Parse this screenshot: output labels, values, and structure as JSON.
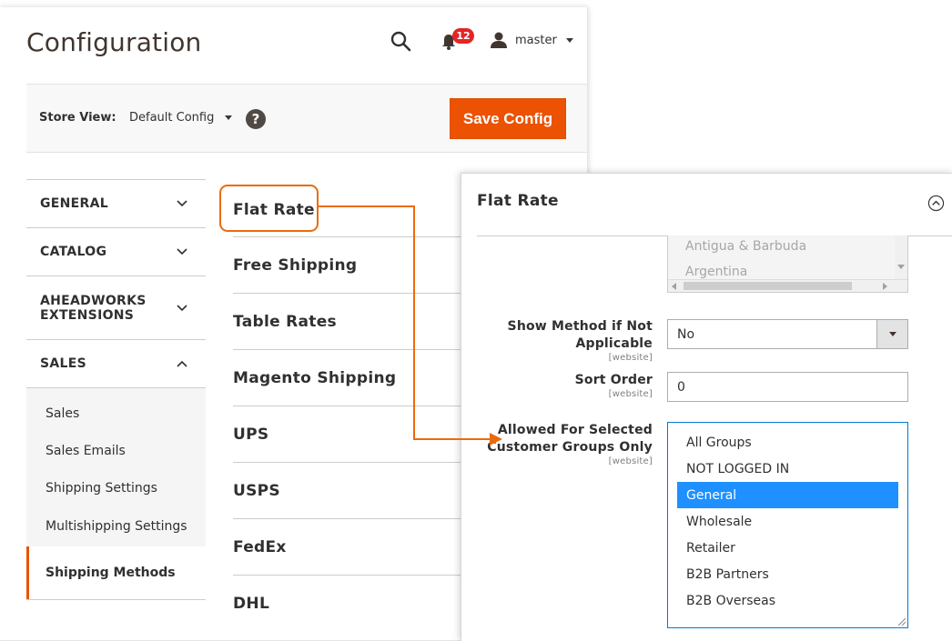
{
  "header": {
    "page_title": "Configuration",
    "notification_count": "12",
    "user_name": "master"
  },
  "store_bar": {
    "label": "Store View:",
    "selected_store": "Default Config",
    "help_glyph": "?",
    "save_label": "Save Config"
  },
  "sidebar": {
    "groups": [
      {
        "label": "GENERAL",
        "expanded": false
      },
      {
        "label": "CATALOG",
        "expanded": false
      },
      {
        "label": "AHEADWORKS EXTENSIONS",
        "expanded": false
      },
      {
        "label": "SALES",
        "expanded": true
      }
    ],
    "sales_items": [
      "Sales",
      "Sales Emails",
      "Shipping Settings",
      "Multishipping Settings",
      "Shipping Methods"
    ],
    "active_item": "Shipping Methods"
  },
  "shipping_methods": [
    "Flat Rate",
    "Free Shipping",
    "Table Rates",
    "Magento Shipping",
    "UPS",
    "USPS",
    "FedEx",
    "DHL"
  ],
  "detail": {
    "title": "Flat Rate",
    "countries": [
      "Antigua & Barbuda",
      "Argentina"
    ],
    "show_method_label_1": "Show Method if Not",
    "show_method_label_2": "Applicable",
    "show_method_value": "No",
    "sort_order_label": "Sort Order",
    "sort_order_value": "0",
    "groups_label_1": "Allowed For Selected",
    "groups_label_2": "Customer Groups Only",
    "scope": "[website]",
    "group_options": [
      "All Groups",
      "NOT LOGGED IN",
      "General",
      "Wholesale",
      "Retailer",
      "B2B Partners",
      "B2B Overseas"
    ],
    "selected_group": "General"
  },
  "colors": {
    "accent": "#eb5202",
    "highlight_outline": "#eb6b0c",
    "selected_option": "#1e90ff",
    "badge": "#e22626"
  }
}
